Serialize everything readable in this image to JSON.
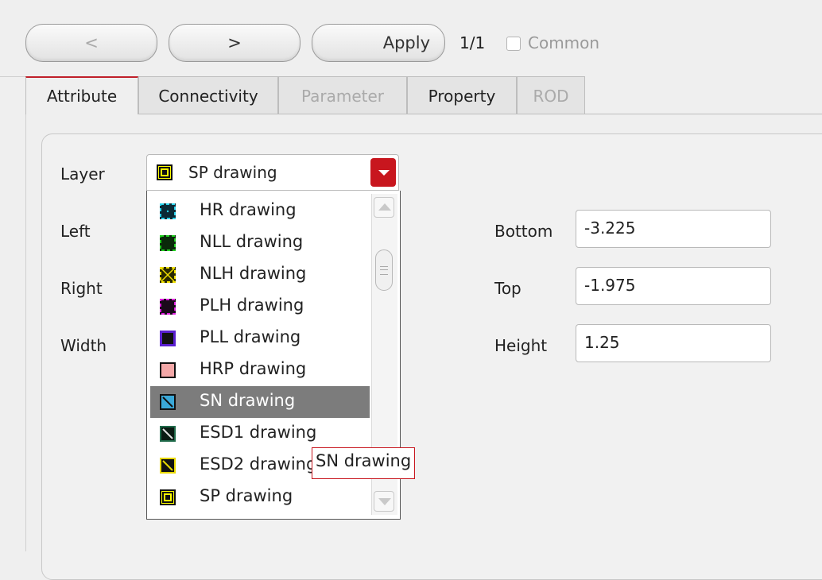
{
  "toolbar": {
    "prev_label": "<",
    "next_label": ">",
    "apply_label": "Apply",
    "counter": "1/1",
    "common_label": "Common",
    "common_checked": false
  },
  "tabs": [
    {
      "label": "Attribute",
      "active": true,
      "enabled": true
    },
    {
      "label": "Connectivity",
      "active": false,
      "enabled": true
    },
    {
      "label": "Parameter",
      "active": false,
      "enabled": false
    },
    {
      "label": "Property",
      "active": false,
      "enabled": true
    },
    {
      "label": "ROD",
      "active": false,
      "enabled": false
    }
  ],
  "form": {
    "layer_label": "Layer",
    "layer_value": "SP drawing",
    "left_label": "Left",
    "right_label": "Right",
    "width_label": "Width",
    "bottom_label": "Bottom",
    "bottom_value": "-3.225",
    "top_label": "Top",
    "top_value": "-1.975",
    "height_label": "Height",
    "height_value": "1.25"
  },
  "dropdown": {
    "items": [
      {
        "label": "HR drawing",
        "icon": "hr-swatch-icon"
      },
      {
        "label": "NLL drawing",
        "icon": "nll-swatch-icon"
      },
      {
        "label": "NLH drawing",
        "icon": "nlh-swatch-icon"
      },
      {
        "label": "PLH drawing",
        "icon": "plh-swatch-icon"
      },
      {
        "label": "PLL drawing",
        "icon": "pll-swatch-icon"
      },
      {
        "label": "HRP drawing",
        "icon": "hrp-swatch-icon"
      },
      {
        "label": "SN drawing",
        "icon": "sn-swatch-icon"
      },
      {
        "label": "ESD1 drawing",
        "icon": "esd1-swatch-icon"
      },
      {
        "label": "ESD2 drawing",
        "icon": "esd2-swatch-icon"
      },
      {
        "label": "SP drawing",
        "icon": "sp-swatch-icon"
      }
    ],
    "highlighted": "SN drawing",
    "tooltip": "SN drawing"
  },
  "colors": {
    "accent": "#c8161e",
    "highlight": "#7c7c7c"
  }
}
